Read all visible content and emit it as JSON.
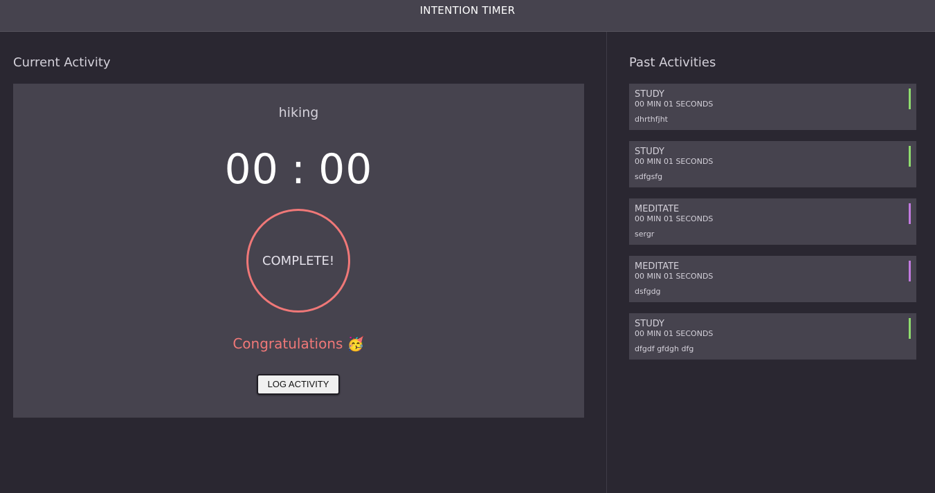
{
  "header": {
    "title": "INTENTION TIMER"
  },
  "current": {
    "section_title": "Current Activity",
    "activity_name": "hiking",
    "minutes": "00",
    "separator": ":",
    "seconds": "00",
    "complete_label": "COMPLETE!",
    "congrats": "Congratulations 🥳",
    "log_button": "LOG ACTIVITY",
    "accent_color": "#f07878"
  },
  "past": {
    "section_title": "Past Activities",
    "items": [
      {
        "type": "STUDY",
        "duration": "00 MIN 01 SECONDS",
        "note": "dhrthfjht",
        "color": "#8fdc6e"
      },
      {
        "type": "STUDY",
        "duration": "00 MIN 01 SECONDS",
        "note": "sdfgsfg",
        "color": "#8fdc6e"
      },
      {
        "type": "MEDITATE",
        "duration": "00 MIN 01 SECONDS",
        "note": "sergr",
        "color": "#c27ae0"
      },
      {
        "type": "MEDITATE",
        "duration": "00 MIN 01 SECONDS",
        "note": "dsfgdg",
        "color": "#c27ae0"
      },
      {
        "type": "STUDY",
        "duration": "00 MIN 01 SECONDS",
        "note": "dfgdf gfdgh dfg",
        "color": "#8fdc6e"
      }
    ]
  }
}
